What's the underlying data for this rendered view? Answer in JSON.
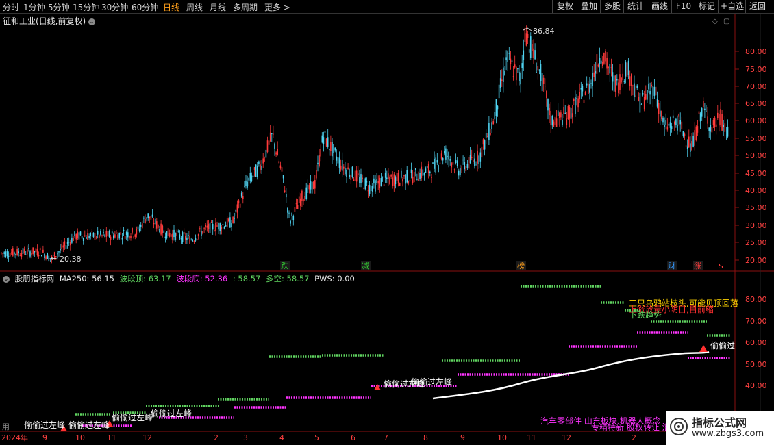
{
  "toolbar": {
    "periods": [
      "分时",
      "1分钟",
      "5分钟",
      "15分钟",
      "30分钟",
      "60分钟",
      "日线",
      "周线",
      "月线",
      "多周期",
      "更多"
    ],
    "active_period": "日线",
    "more_arrow": ">",
    "buttons": [
      "复权",
      "叠加",
      "多股",
      "统计",
      "画线",
      "F10",
      "标记",
      "+自选",
      "返回"
    ]
  },
  "stock": {
    "title": "征和工业(日线,前复权)",
    "toggle_icon": "chevron-down-icon"
  },
  "main_chart": {
    "price_axis": [
      "80.00",
      "75.00",
      "70.00",
      "65.00",
      "60.00",
      "55.00",
      "50.00",
      "45.00",
      "40.00",
      "35.00",
      "30.00",
      "25.00",
      "20.00"
    ],
    "high_label": "86.84",
    "low_label": "20.38",
    "markers": [
      {
        "text": "跌",
        "color": "#33cc33"
      },
      {
        "text": "减",
        "color": "#33cc33"
      },
      {
        "text": "榜",
        "color": "#ff9f1a"
      },
      {
        "text": "财",
        "color": "#3399ff"
      },
      {
        "text": "涨",
        "color": "#ff3b3b"
      },
      {
        "text": "$",
        "color": "#ff3b3b"
      }
    ]
  },
  "indicator": {
    "name": "股朋指标网",
    "ma250": "MA250: 56.15",
    "top": "波段顶: 63.17",
    "bottom": "波段底: 52.36",
    "colon_val": ": 58.57",
    "longshort": "多空: 58.57",
    "pws": "PWS: 0.00",
    "axis": [
      "80.00",
      "70.00",
      "60.00",
      "50.00",
      "40.00"
    ],
    "annotations": {
      "steal": "偷偷过左峰",
      "steal_short": "偷偷过",
      "crow": "三只乌鸦站枝头,可能见顶回落",
      "volume": "上涨放量小阴日,目前缩",
      "trend": "下跌趋势",
      "sector1": "汽车零部件 山东板块 机器人概念",
      "sector2": "专精特新 股权转让 潜力",
      "left": "用"
    }
  },
  "dates": [
    "2024年",
    "9",
    "10",
    "11",
    "12",
    "2",
    "3",
    "4",
    "5",
    "6",
    "7",
    "8",
    "9",
    "10",
    "11",
    "12",
    "2"
  ],
  "watermark": {
    "line1": "指标公式网",
    "line2": "www.zbgs3.com"
  },
  "colors": {
    "up": "#ff3b3b",
    "down": "#4fd2f0",
    "green": "#5fd35f",
    "magenta": "#ff33ff",
    "axis": "#8a1010"
  }
}
